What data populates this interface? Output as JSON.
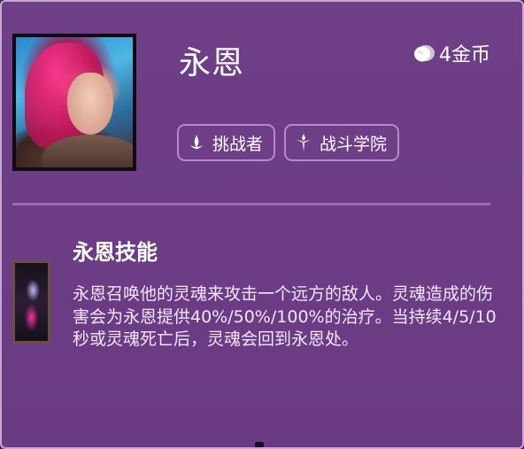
{
  "hero": {
    "name": "永恩",
    "cost_label": "4金币",
    "portrait_icon": "champion-portrait",
    "traits": [
      {
        "icon": "challenger-trait-icon",
        "label": "挑战者"
      },
      {
        "icon": "academy-trait-icon",
        "label": "战斗学院"
      }
    ]
  },
  "skill": {
    "title": "永恩技能",
    "description": "永恩召唤他的灵魂来攻击一个远方的敌人。灵魂造成的伤害会为永恩提供40%/50%/100%的治疗。当持续4/5/10秒或灵魂死亡后，灵魂会回到永恩处。"
  },
  "colors": {
    "background": "#6e3f87",
    "border": "#c7a6d9",
    "divider": "#9a6cb7",
    "text": "#ffffff"
  }
}
